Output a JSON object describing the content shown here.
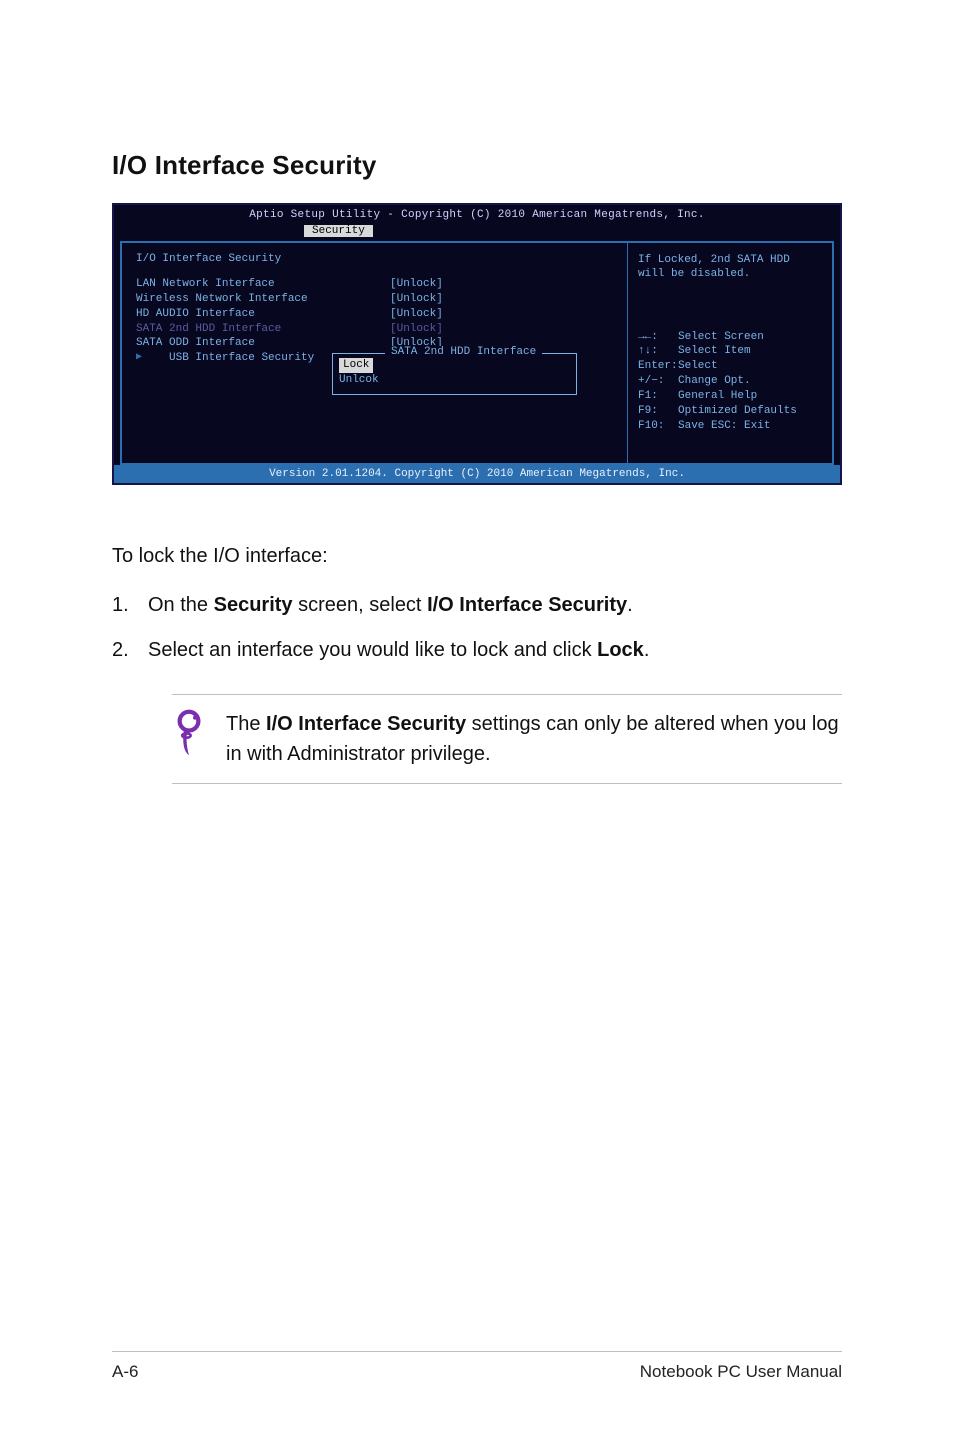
{
  "heading": "I/O Interface Security",
  "bios": {
    "header_title": "Aptio Setup Utility - Copyright (C) 2010 American Megatrends, Inc.",
    "tab_label": "Security",
    "page_title": "I/O Interface Security",
    "items": [
      {
        "label": "LAN Network Interface",
        "value": "[Unlock]",
        "dim": false
      },
      {
        "label": "Wireless Network Interface",
        "value": "[Unlock]",
        "dim": false
      },
      {
        "label": "HD AUDIO Interface",
        "value": "[Unlock]",
        "dim": false
      },
      {
        "label": "SATA 2nd HDD Interface",
        "value": "[Unlock]",
        "dim": true
      },
      {
        "label": "SATA ODD Interface",
        "value": "[Unlock]",
        "dim": false
      }
    ],
    "submenu_label": "USB Interface Security",
    "popup": {
      "title": "SATA 2nd HDD Interface",
      "options": [
        "Lock",
        "Unlcok"
      ]
    },
    "help_top": "If Locked, 2nd SATA HDD will be disabled.",
    "help_keys": [
      {
        "k": "→←:",
        "d": "Select Screen"
      },
      {
        "k": "↑↓:",
        "d": "Select Item"
      },
      {
        "k": "Enter:",
        "d": "Select"
      },
      {
        "k": "+/−:",
        "d": "Change Opt."
      },
      {
        "k": "F1:",
        "d": "General Help"
      },
      {
        "k": "F9:",
        "d": "Optimized Defaults"
      },
      {
        "k": "F10:",
        "d": "Save    ESC: Exit"
      }
    ],
    "footer": "Version 2.01.1204. Copyright (C) 2010 American Megatrends, Inc."
  },
  "instructions": {
    "lead": "To lock the I/O interface:",
    "steps": [
      {
        "num": "1.",
        "pre": "On the ",
        "bold1": "Security",
        "mid": " screen, select ",
        "bold2": "I/O Interface Security",
        "post": "."
      },
      {
        "num": "2.",
        "pre": "Select an interface you would like to lock and click ",
        "bold1": "Lock",
        "mid": "",
        "bold2": "",
        "post": "."
      }
    ],
    "note_pre": "The ",
    "note_bold": "I/O Interface Security",
    "note_post": " settings can only be altered when you log in with Administrator privilege."
  },
  "footer": {
    "left": "A-6",
    "right": "Notebook PC User Manual"
  }
}
